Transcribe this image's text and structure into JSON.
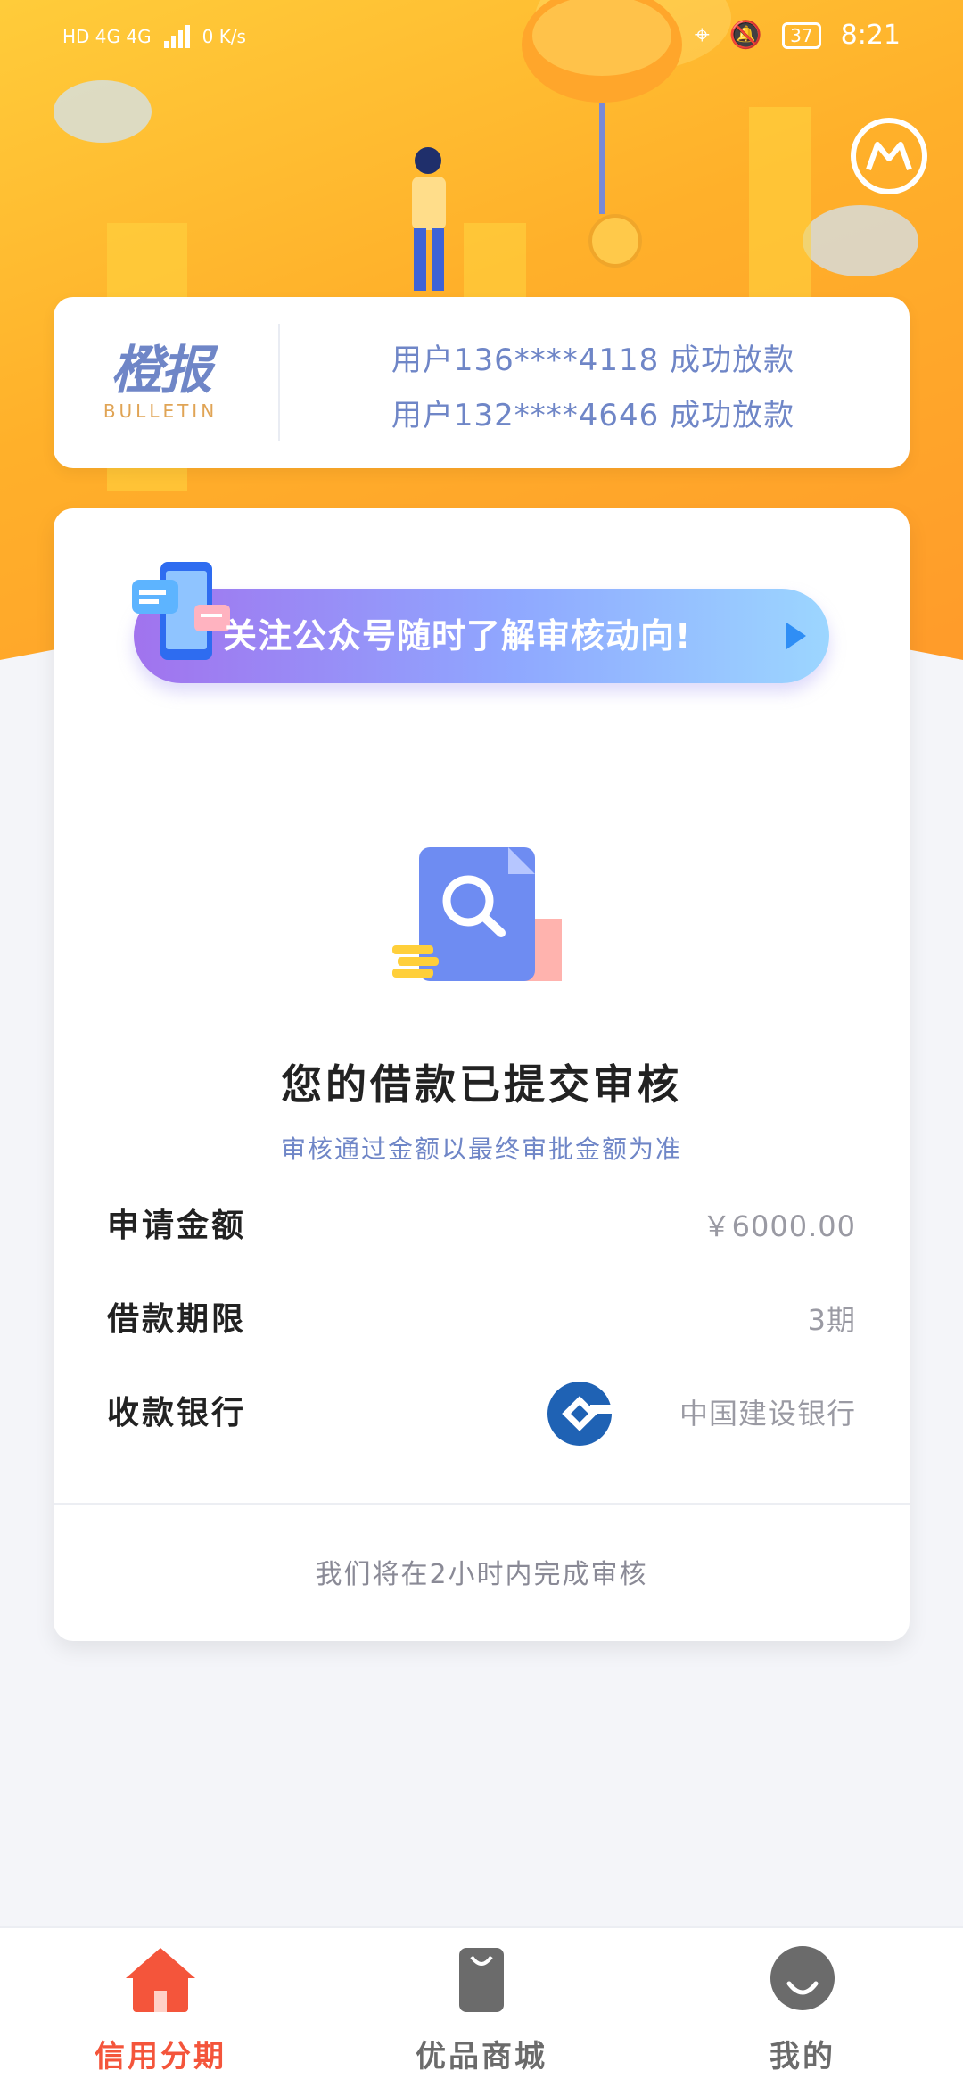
{
  "status_bar": {
    "network": "HD 4G 4G",
    "speed": "0 K/s",
    "battery": "37",
    "time": "8:21"
  },
  "bulletin": {
    "logo_cn": "橙报",
    "logo_en": "BULLETIN",
    "items": [
      "用户136****4118 成功放款",
      "用户132****4646 成功放款"
    ]
  },
  "banner": {
    "text": "关注公众号随时了解审核动向!"
  },
  "status": {
    "title": "您的借款已提交审核",
    "subtitle": "审核通过金额以最终审批金额为准"
  },
  "details": [
    {
      "label": "申请金额",
      "value": "￥6000.00"
    },
    {
      "label": "借款期限",
      "value": "3期"
    },
    {
      "label": "收款银行",
      "value": "中国建设银行"
    }
  ],
  "footer_note": "我们将在2小时内完成审核",
  "bottom_nav": [
    {
      "label": "信用分期",
      "icon": "home-icon",
      "active": true
    },
    {
      "label": "优品商城",
      "icon": "shopping-bag-icon",
      "active": false
    },
    {
      "label": "我的",
      "icon": "profile-icon",
      "active": false
    }
  ],
  "colors": {
    "accent_active": "#f4553b",
    "inactive": "#6b6b6b",
    "blue_text": "#6f86c7",
    "hero_orange": "#ffb02a",
    "bank_blue": "#1f62b4"
  }
}
